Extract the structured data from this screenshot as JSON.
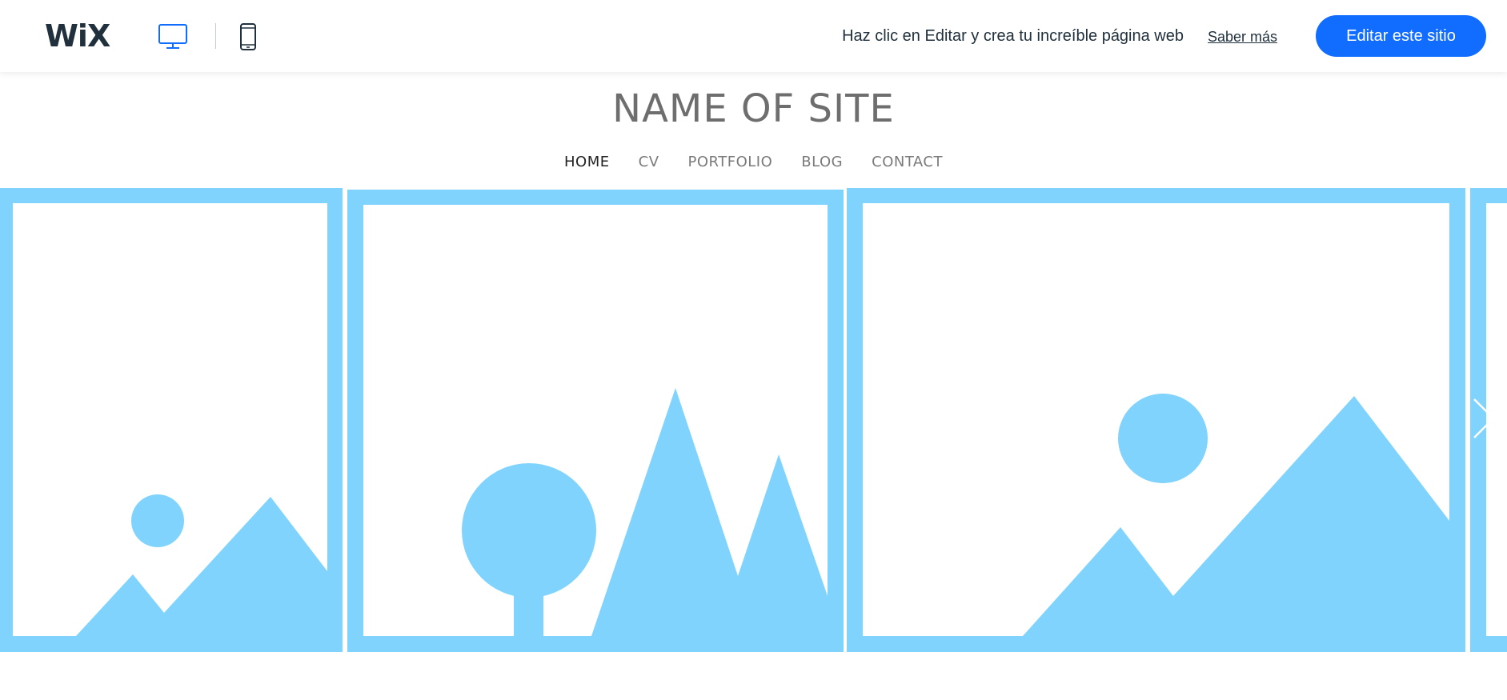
{
  "topbar": {
    "logo": "WiX",
    "promo_text": "Haz clic en Editar y crea tu increíble página web",
    "learn_more_label": "Saber más",
    "edit_button_label": "Editar este sitio",
    "accent_color": "#116dff"
  },
  "site": {
    "title": "NAME OF SITE",
    "nav": [
      {
        "label": "HOME",
        "active": true
      },
      {
        "label": "CV",
        "active": false
      },
      {
        "label": "PORTFOLIO",
        "active": false
      },
      {
        "label": "BLOG",
        "active": false
      },
      {
        "label": "CONTACT",
        "active": false
      }
    ]
  },
  "gallery": {
    "placeholder_color": "#7fd3fd",
    "items": [
      {
        "kind": "image-placeholder",
        "scene": "sun-mountains"
      },
      {
        "kind": "image-placeholder",
        "scene": "tree-mountains"
      },
      {
        "kind": "image-placeholder",
        "scene": "sun-mountains"
      },
      {
        "kind": "image-placeholder",
        "scene": "partial"
      }
    ],
    "next_icon": "chevron-right-icon"
  }
}
